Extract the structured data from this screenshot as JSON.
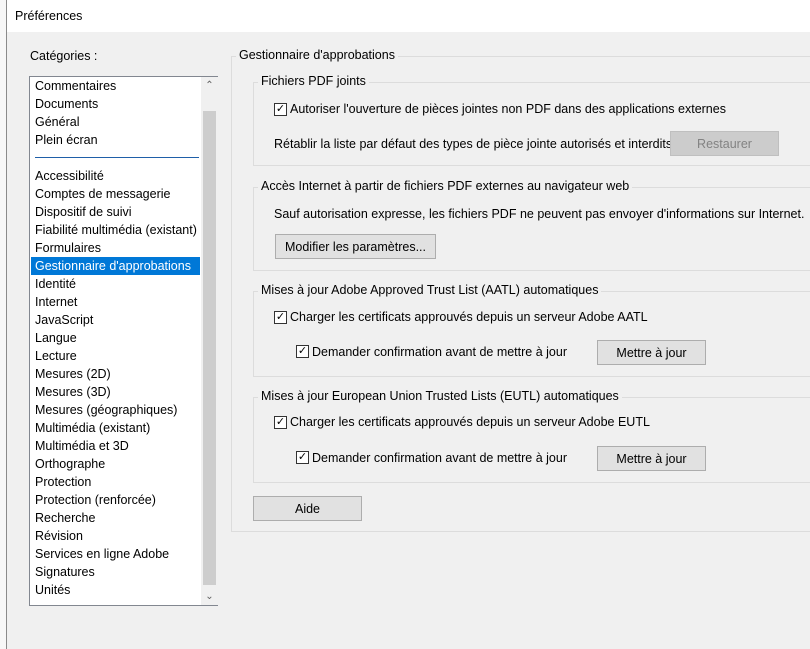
{
  "window": {
    "title": "Préférences"
  },
  "sidebar": {
    "label": "Catégories :",
    "group1": [
      "Commentaires",
      "Documents",
      "Général",
      "Plein écran"
    ],
    "group2": [
      "Accessibilité",
      "Comptes de messagerie",
      "Dispositif de suivi",
      "Fiabilité multimédia (existant)",
      "Formulaires",
      "Gestionnaire d'approbations",
      "Identité",
      "Internet",
      "JavaScript",
      "Langue",
      "Lecture",
      "Mesures (2D)",
      "Mesures (3D)",
      "Mesures (géographiques)",
      "Multimédia (existant)",
      "Multimédia et 3D",
      "Orthographe",
      "Protection",
      "Protection (renforcée)",
      "Recherche",
      "Révision",
      "Services en ligne Adobe",
      "Signatures",
      "Unités"
    ],
    "selected": "Gestionnaire d'approbations"
  },
  "main": {
    "title": "Gestionnaire d'approbations",
    "attachments": {
      "title": "Fichiers PDF joints",
      "allow_label": "Autoriser l'ouverture de pièces jointes non PDF dans des applications externes",
      "allow_checked": true,
      "restore_text": "Rétablir la liste par défaut des types de pièce jointe autorisés et interdits :",
      "restore_button": "Restaurer"
    },
    "internet": {
      "title": "Accès Internet à partir de fichiers PDF externes au navigateur web",
      "info": "Sauf autorisation expresse, les fichiers PDF ne peuvent pas envoyer d'informations sur Internet.",
      "button": "Modifier les paramètres..."
    },
    "aatl": {
      "title": "Mises à jour Adobe Approved Trust List (AATL) automatiques",
      "load_label": "Charger les certificats approuvés depuis un serveur Adobe AATL",
      "load_checked": true,
      "confirm_label": "Demander confirmation avant de mettre à jour",
      "confirm_checked": true,
      "update_button": "Mettre à jour"
    },
    "eutl": {
      "title": "Mises à jour European Union Trusted Lists (EUTL) automatiques",
      "load_label": "Charger les certificats approuvés depuis un serveur Adobe EUTL",
      "load_checked": true,
      "confirm_label": "Demander confirmation avant de mettre à jour",
      "confirm_checked": true,
      "update_button": "Mettre à jour"
    },
    "help_button": "Aide"
  }
}
